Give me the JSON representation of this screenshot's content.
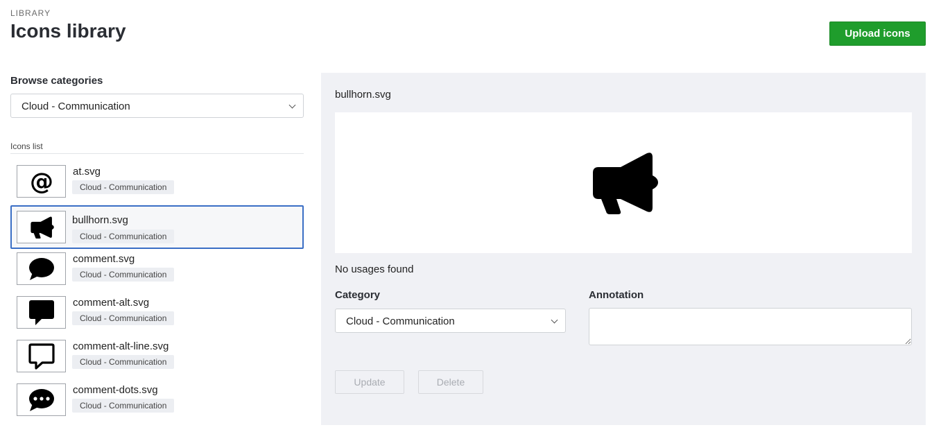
{
  "header": {
    "eyebrow": "LIBRARY",
    "title": "Icons library",
    "upload_label": "Upload icons",
    "upload_color": "#1f9d2c"
  },
  "browse": {
    "label": "Browse categories",
    "selected": "Cloud - Communication"
  },
  "icons_list": {
    "header": "Icons list",
    "items": [
      {
        "name": "at.svg",
        "category": "Cloud - Communication",
        "icon": "at-icon",
        "selected": false
      },
      {
        "name": "bullhorn.svg",
        "category": "Cloud - Communication",
        "icon": "bullhorn-icon",
        "selected": true
      },
      {
        "name": "comment.svg",
        "category": "Cloud - Communication",
        "icon": "comment-icon",
        "selected": false
      },
      {
        "name": "comment-alt.svg",
        "category": "Cloud - Communication",
        "icon": "comment-alt-icon",
        "selected": false
      },
      {
        "name": "comment-alt-line.svg",
        "category": "Cloud - Communication",
        "icon": "comment-alt-line-icon",
        "selected": false
      },
      {
        "name": "comment-dots.svg",
        "category": "Cloud - Communication",
        "icon": "comment-dots-icon",
        "selected": false
      }
    ]
  },
  "detail": {
    "file_name": "bullhorn.svg",
    "preview_icon": "bullhorn-icon",
    "usages": "No usages found",
    "category_label": "Category",
    "category_value": "Cloud - Communication",
    "annotation_label": "Annotation",
    "annotation_value": "",
    "update_label": "Update",
    "delete_label": "Delete"
  },
  "colors": {
    "selection_border": "#3a6ec5",
    "panel_bg": "#f0f1f5"
  }
}
